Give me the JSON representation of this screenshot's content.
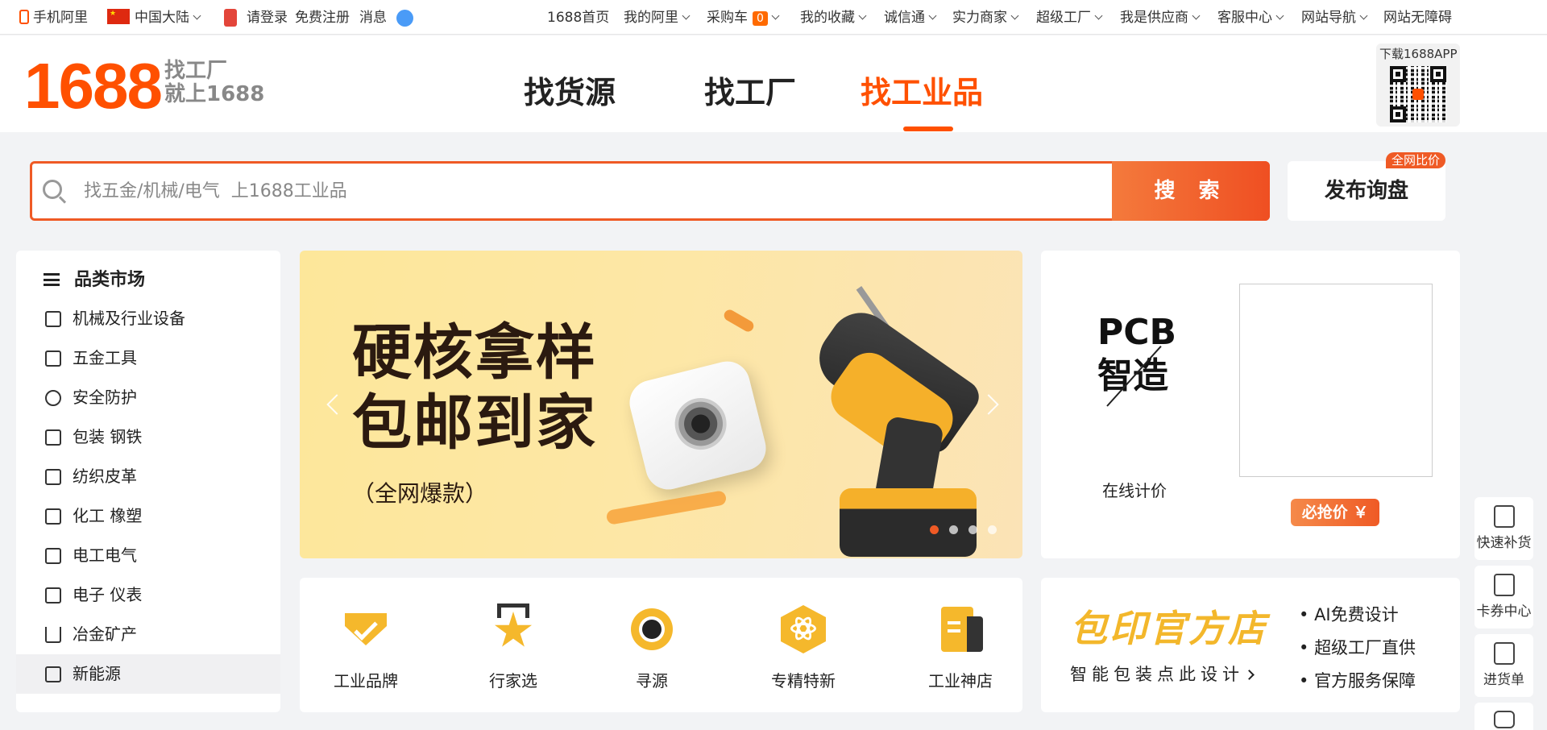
{
  "topbar": {
    "mobile": "手机阿里",
    "region": "中国大陆",
    "login": "请登录",
    "register": "免费注册",
    "messages": "消息",
    "home": "1688首页",
    "my_ali": "我的阿里",
    "cart": "采购车",
    "cart_count": "0",
    "favorites": "我的收藏",
    "chengxin": "诚信通",
    "power_merchant": "实力商家",
    "super_factory": "超级工厂",
    "supplier": "我是供应商",
    "service": "客服中心",
    "site_nav": "网站导航",
    "accessibility": "网站无障碍"
  },
  "header": {
    "logo": "1688",
    "slogan_1": "找工厂",
    "slogan_2": "就上1688",
    "tabs": [
      {
        "label": "找货源"
      },
      {
        "label": "找工厂"
      },
      {
        "label": "找工业品"
      }
    ],
    "active_tab": 2,
    "qr_label": "下载1688APP"
  },
  "search": {
    "placeholder": "找五金/机械/电气  上1688工业品",
    "button": "搜 索",
    "publish": "发布询盘",
    "compare_badge": "全网比价"
  },
  "sidebar": {
    "title": "品类市场",
    "items": [
      {
        "label": "机械及行业设备",
        "icon": "machine-icon"
      },
      {
        "label": "五金工具",
        "icon": "hardware-icon"
      },
      {
        "label": "安全防护",
        "icon": "safety-icon"
      },
      {
        "label": "包装  钢铁",
        "icon": "package-icon"
      },
      {
        "label": "纺织皮革",
        "icon": "textile-icon"
      },
      {
        "label": "化工  橡塑",
        "icon": "chemical-icon"
      },
      {
        "label": "电工电气",
        "icon": "electric-icon"
      },
      {
        "label": "电子  仪表",
        "icon": "chip-icon"
      },
      {
        "label": "冶金矿产",
        "icon": "mining-icon"
      },
      {
        "label": "新能源",
        "icon": "energy-icon"
      }
    ]
  },
  "banner": {
    "line1": "硬核拿样",
    "line2": "包邮到家",
    "line3": "（全网爆款）",
    "slides": 4,
    "active_slide": 0
  },
  "pcb": {
    "title_1": "PCB",
    "title_2": "智造",
    "subtitle": "在线计价",
    "price_button": "必抢价 ￥"
  },
  "features": [
    {
      "label": "工业品牌",
      "icon": "brand-icon",
      "color": "#f5b82c"
    },
    {
      "label": "行家选",
      "icon": "star-icon",
      "color": "#f5b82c"
    },
    {
      "label": "寻源",
      "icon": "target-icon",
      "color": "#f5b82c"
    },
    {
      "label": "专精特新",
      "icon": "atom-icon",
      "color": "#f5b82c"
    },
    {
      "label": "工业神店",
      "icon": "store-icon",
      "color": "#f5b82c"
    }
  ],
  "print_store": {
    "title": "包印官方店",
    "subtitle": "智能包装点此设计",
    "bullets": [
      "AI免费设计",
      "超级工厂直供",
      "官方服务保障"
    ]
  },
  "float_bar": [
    {
      "label": "快速补货",
      "icon": "restock-icon"
    },
    {
      "label": "卡券中心",
      "icon": "coupon-icon"
    },
    {
      "label": "进货单",
      "icon": "order-list-icon"
    },
    {
      "label": "",
      "icon": "chat-icon"
    }
  ],
  "colors": {
    "accent": "#ff5000",
    "search_border": "#ef5a25",
    "gold": "#f5b82c"
  }
}
